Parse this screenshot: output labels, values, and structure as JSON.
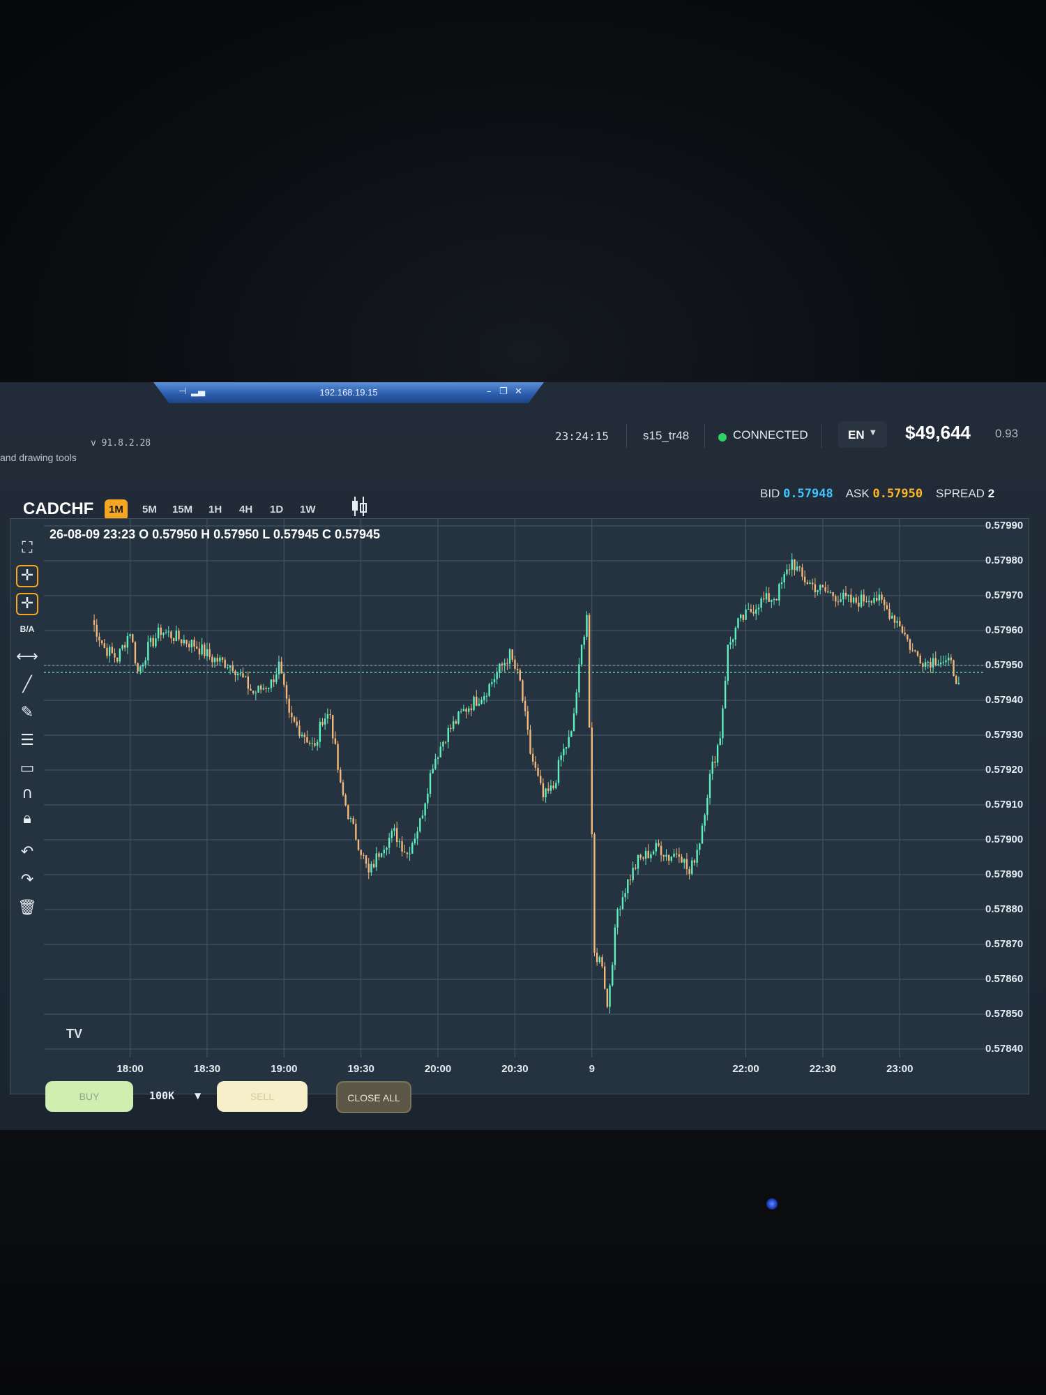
{
  "remote_session": {
    "host": "192.168.19.15"
  },
  "app": {
    "version": "v 91.8.2.28",
    "tools_hint": "and drawing tools",
    "server_time": "23:24:15",
    "account_id": "s15_tr48",
    "connection_status": "CONNECTED",
    "language": "EN",
    "balance": "$49,644",
    "balance_extra": "0.93"
  },
  "symbol_bar": {
    "symbol": "CADCHF",
    "timeframes": [
      "1M",
      "5M",
      "15M",
      "1H",
      "4H",
      "1D",
      "1W"
    ],
    "active_timeframe": "1M"
  },
  "quote": {
    "bid_label": "BID",
    "bid": "0.57948",
    "ask_label": "ASK",
    "ask": "0.57950",
    "spread_label": "SPREAD",
    "spread": "2"
  },
  "ohlc_legend": "26-08-09 23:23 O 0.57950 H 0.57950 L 0.57945 C 0.57945",
  "toolbar": {
    "ba_label": "B/A",
    "logo_text": "TV"
  },
  "trade_panel": {
    "buy_label": "BUY",
    "lot_size": "100K",
    "sell_label": "SELL",
    "close_all_label": "CLOSE ALL"
  },
  "colors": {
    "accent": "#f5a623",
    "bid": "#40c4ff",
    "ask": "#ffb627",
    "up": "#5ff0c0",
    "down": "#f3b87a",
    "connected": "#31d063"
  },
  "chart_data": {
    "type": "candlestick",
    "timeframe": "1M",
    "y_ticks": [
      "0.57990",
      "0.57980",
      "0.57970",
      "0.57960",
      "0.57950",
      "0.57940",
      "0.57930",
      "0.57920",
      "0.57910",
      "0.57900",
      "0.57890",
      "0.57880",
      "0.57870",
      "0.57860",
      "0.57850",
      "0.57840"
    ],
    "x_ticks": [
      "18:00",
      "18:30",
      "19:00",
      "19:30",
      "20:00",
      "20:30",
      "9",
      "22:00",
      "22:30",
      "23:00"
    ],
    "ylim": [
      0.5784,
      0.57992
    ],
    "bid_line": 0.57948,
    "ask_line": 0.5795,
    "price_path": [
      [
        "17:45",
        0.57963
      ],
      [
        "17:50",
        0.57955
      ],
      [
        "17:55",
        0.57952
      ],
      [
        "18:00",
        0.5796
      ],
      [
        "18:03",
        0.57948
      ],
      [
        "18:07",
        0.57955
      ],
      [
        "18:12",
        0.5796
      ],
      [
        "18:18",
        0.57958
      ],
      [
        "18:25",
        0.57956
      ],
      [
        "18:32",
        0.57952
      ],
      [
        "18:40",
        0.5795
      ],
      [
        "18:48",
        0.57942
      ],
      [
        "18:55",
        0.57945
      ],
      [
        "18:58",
        0.5795
      ],
      [
        "19:02",
        0.57935
      ],
      [
        "19:08",
        0.5793
      ],
      [
        "19:12",
        0.57926
      ],
      [
        "19:15",
        0.57935
      ],
      [
        "19:18",
        0.57936
      ],
      [
        "19:22",
        0.57915
      ],
      [
        "19:26",
        0.57905
      ],
      [
        "19:30",
        0.57897
      ],
      [
        "19:33",
        0.5789
      ],
      [
        "19:38",
        0.57898
      ],
      [
        "19:43",
        0.57902
      ],
      [
        "19:48",
        0.57896
      ],
      [
        "19:53",
        0.57905
      ],
      [
        "19:58",
        0.57922
      ],
      [
        "20:03",
        0.5793
      ],
      [
        "20:10",
        0.57937
      ],
      [
        "20:18",
        0.57942
      ],
      [
        "20:25",
        0.5795
      ],
      [
        "20:28",
        0.57953
      ],
      [
        "20:32",
        0.57945
      ],
      [
        "20:36",
        0.57925
      ],
      [
        "20:41",
        0.57912
      ],
      [
        "20:45",
        0.57915
      ],
      [
        "20:48",
        0.57924
      ],
      [
        "20:52",
        0.5793
      ],
      [
        "20:56",
        0.57955
      ],
      [
        "20:58",
        0.57965
      ],
      [
        "21:01",
        0.57867
      ],
      [
        "21:04",
        0.57865
      ],
      [
        "21:06",
        0.57852
      ],
      [
        "21:10",
        0.5788
      ],
      [
        "21:14",
        0.57888
      ],
      [
        "21:18",
        0.57894
      ],
      [
        "21:22",
        0.57896
      ],
      [
        "21:26",
        0.57898
      ],
      [
        "21:30",
        0.57895
      ],
      [
        "21:34",
        0.57897
      ],
      [
        "21:38",
        0.5789
      ],
      [
        "21:42",
        0.579
      ],
      [
        "21:46",
        0.57918
      ],
      [
        "21:50",
        0.5793
      ],
      [
        "21:53",
        0.57955
      ],
      [
        "21:57",
        0.57962
      ],
      [
        "22:05",
        0.57968
      ],
      [
        "22:12",
        0.5797
      ],
      [
        "22:18",
        0.5798
      ],
      [
        "22:22",
        0.57975
      ],
      [
        "22:28",
        0.57972
      ],
      [
        "22:35",
        0.5797
      ],
      [
        "22:42",
        0.57968
      ],
      [
        "22:50",
        0.5797
      ],
      [
        "22:55",
        0.57966
      ],
      [
        "23:00",
        0.57962
      ],
      [
        "23:05",
        0.57954
      ],
      [
        "23:10",
        0.57951
      ],
      [
        "23:15",
        0.57952
      ],
      [
        "23:20",
        0.5795
      ],
      [
        "23:23",
        0.57945
      ]
    ]
  }
}
